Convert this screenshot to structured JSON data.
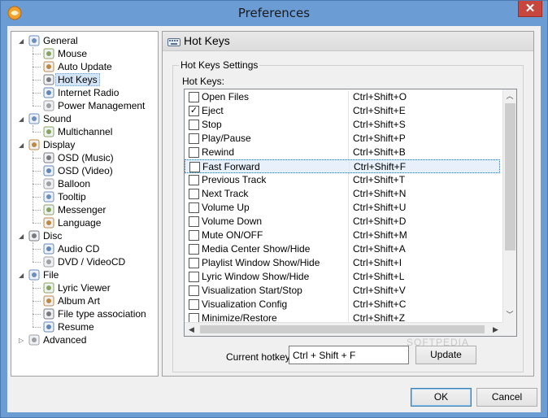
{
  "window": {
    "title": "Preferences",
    "close_glyph": "✕"
  },
  "tree": [
    {
      "label": "General",
      "level": 0,
      "expander": "◢",
      "icon": "checklist-icon"
    },
    {
      "label": "Mouse",
      "level": 1,
      "icon": "mouse-icon"
    },
    {
      "label": "Auto Update",
      "level": 1,
      "icon": "globe-icon"
    },
    {
      "label": "Hot Keys",
      "level": 1,
      "icon": "keyboard-icon",
      "selected": true
    },
    {
      "label": "Internet Radio",
      "level": 1,
      "icon": "radio-icon"
    },
    {
      "label": "Power Management",
      "level": 1,
      "icon": "battery-icon"
    },
    {
      "label": "Sound",
      "level": 0,
      "expander": "◢",
      "icon": "speaker-icon"
    },
    {
      "label": "Multichannel",
      "level": 1,
      "icon": "multichannel-icon"
    },
    {
      "label": "Display",
      "level": 0,
      "expander": "◢",
      "icon": "monitor-icon"
    },
    {
      "label": "OSD (Music)",
      "level": 1,
      "icon": "osd-music-icon"
    },
    {
      "label": "OSD (Video)",
      "level": 1,
      "icon": "osd-video-icon"
    },
    {
      "label": "Balloon",
      "level": 1,
      "icon": "balloon-icon"
    },
    {
      "label": "Tooltip",
      "level": 1,
      "icon": "tooltip-icon"
    },
    {
      "label": "Messenger",
      "level": 1,
      "icon": "messenger-icon"
    },
    {
      "label": "Language",
      "level": 1,
      "icon": "language-icon"
    },
    {
      "label": "Disc",
      "level": 0,
      "expander": "◢",
      "icon": "disc-icon"
    },
    {
      "label": "Audio CD",
      "level": 1,
      "icon": "audio-cd-icon"
    },
    {
      "label": "DVD / VideoCD",
      "level": 1,
      "icon": "dvd-icon"
    },
    {
      "label": "File",
      "level": 0,
      "expander": "◢",
      "icon": "file-icon"
    },
    {
      "label": "Lyric Viewer",
      "level": 1,
      "icon": "lyric-icon"
    },
    {
      "label": "Album Art",
      "level": 1,
      "icon": "album-art-icon"
    },
    {
      "label": "File type association",
      "level": 1,
      "icon": "file-association-icon"
    },
    {
      "label": "Resume",
      "level": 1,
      "icon": "resume-icon"
    },
    {
      "label": "Advanced",
      "level": 0,
      "expander": "▷",
      "icon": "advanced-icon"
    }
  ],
  "panel": {
    "title": "Hot Keys",
    "group_title": "Hot Keys Settings",
    "list_label": "Hot Keys:",
    "hotkeys": [
      {
        "name": "Open Files",
        "key": "Ctrl+Shift+O",
        "checked": false
      },
      {
        "name": "Eject",
        "key": "Ctrl+Shift+E",
        "checked": true
      },
      {
        "name": "Stop",
        "key": "Ctrl+Shift+S",
        "checked": false
      },
      {
        "name": "Play/Pause",
        "key": "Ctrl+Shift+P",
        "checked": false
      },
      {
        "name": "Rewind",
        "key": "Ctrl+Shift+B",
        "checked": false
      },
      {
        "name": "Fast Forward",
        "key": "Ctrl+Shift+F",
        "checked": false,
        "focused": true
      },
      {
        "name": "Previous Track",
        "key": "Ctrl+Shift+T",
        "checked": false
      },
      {
        "name": "Next Track",
        "key": "Ctrl+Shift+N",
        "checked": false
      },
      {
        "name": "Volume Up",
        "key": "Ctrl+Shift+U",
        "checked": false
      },
      {
        "name": "Volume Down",
        "key": "Ctrl+Shift+D",
        "checked": false
      },
      {
        "name": "Mute ON/OFF",
        "key": "Ctrl+Shift+M",
        "checked": false
      },
      {
        "name": "Media Center Show/Hide",
        "key": "Ctrl+Shift+A",
        "checked": false
      },
      {
        "name": "Playlist Window Show/Hide",
        "key": "Ctrl+Shift+I",
        "checked": false
      },
      {
        "name": "Lyric Window Show/Hide",
        "key": "Ctrl+Shift+L",
        "checked": false
      },
      {
        "name": "Visualization Start/Stop",
        "key": "Ctrl+Shift+V",
        "checked": false
      },
      {
        "name": "Visualization Config",
        "key": "Ctrl+Shift+C",
        "checked": false
      },
      {
        "name": "Minimize/Restore",
        "key": "Ctrl+Shift+Z",
        "checked": false
      }
    ],
    "current_hotkey_label": "Current hotkey:",
    "current_hotkey_value": "Ctrl + Shift + F",
    "update_label": "Update"
  },
  "buttons": {
    "ok": "OK",
    "cancel": "Cancel"
  },
  "watermark": "SOFTPEDIA",
  "colors": {
    "titlebar": "#6c9cd4",
    "close": "#c7463d",
    "focus": "#2a6ec4"
  }
}
